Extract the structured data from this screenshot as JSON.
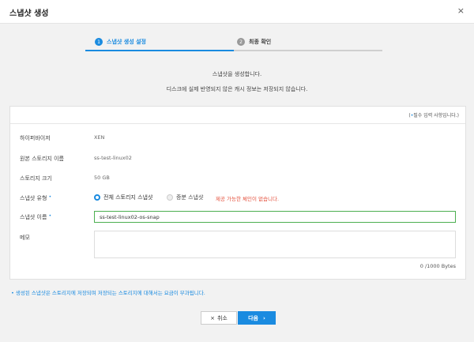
{
  "window": {
    "title": "스냅샷 생성",
    "close_icon": "×"
  },
  "steps": [
    {
      "num": "1",
      "label": "스냅샷 생성 설정"
    },
    {
      "num": "2",
      "label": "최종 확인"
    }
  ],
  "description": {
    "line1": "스냅샷을 생성합니다.",
    "line2": "디스크에 실제 반영되지 않은 캐시 정보는 저장되지 않습니다."
  },
  "form": {
    "required_hint_open": "(",
    "required_hint_dot": "•",
    "required_hint_text": "필수 입력 사항입니다.)",
    "hypervisor": {
      "label": "하이퍼바이저",
      "value": "XEN"
    },
    "source_storage": {
      "label": "원본 스토리지 이름",
      "value": "ss-test-linux02"
    },
    "storage_size": {
      "label": "스토리지 크기",
      "value": "50 GB"
    },
    "snapshot_type": {
      "label": "스냅샷 유형",
      "req": "•",
      "options": [
        "전체 스토리지 스냅샷",
        "증분 스냅샷"
      ],
      "warning": "제공 가능한 체인이 없습니다."
    },
    "snapshot_name": {
      "label": "스냅샷 이름",
      "req": "•",
      "value": "ss-test-linux02-os-snap"
    },
    "memo": {
      "label": "메모",
      "value": "",
      "counter": "0 /1000 Bytes"
    }
  },
  "note": "•  생성된 스냅샷은 스토리지에 저장되며 저장되는 스토리지에 대해서는 요금이 부과됩니다.",
  "buttons": {
    "cancel": {
      "icon": "×",
      "label": "취소"
    },
    "next": {
      "label": "다음",
      "icon": "›"
    }
  },
  "colors": {
    "accent": "#1a8be0",
    "warning": "#e4513d",
    "input_focus": "#4caf50"
  }
}
